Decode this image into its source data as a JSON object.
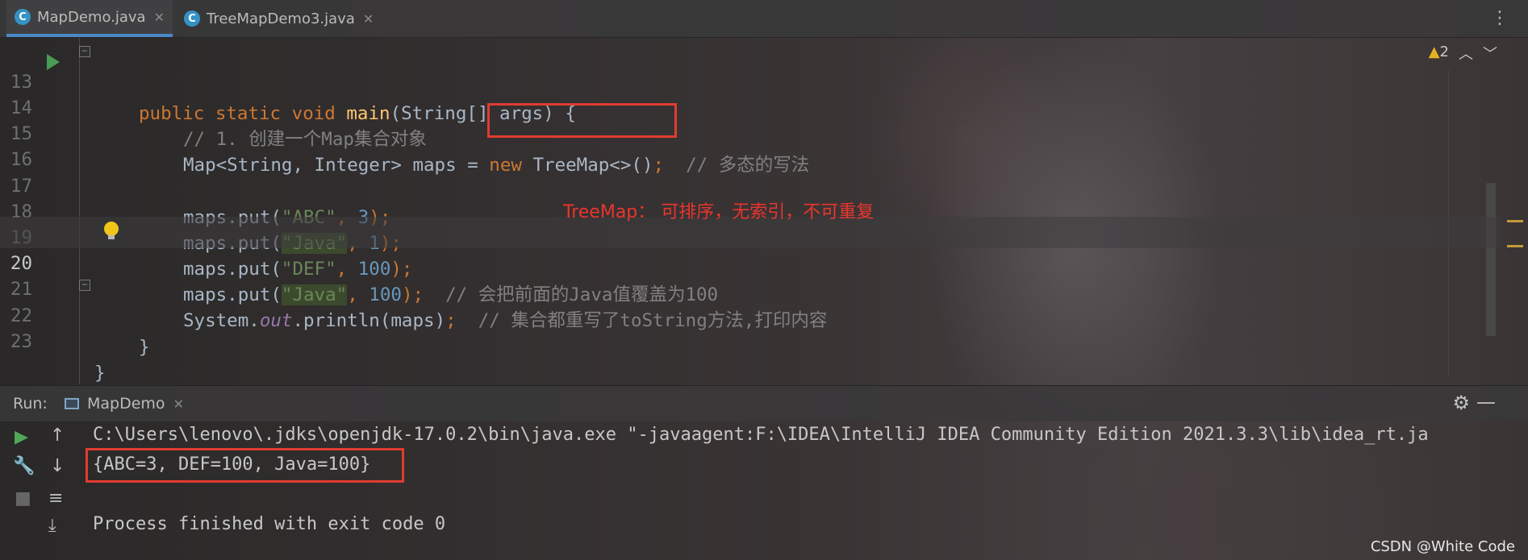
{
  "tabs": [
    {
      "label": "MapDemo.java",
      "icon": "C",
      "active": true
    },
    {
      "label": "TreeMapDemo3.java",
      "icon": "C",
      "active": false
    }
  ],
  "editor": {
    "warnings_count": "2",
    "lines": {
      "l13": {
        "num": "13",
        "indent": "    ",
        "kw1": "public",
        "kw2": "static",
        "kw3": "void",
        "fn": "main",
        "rest": "(String[] args) {"
      },
      "l14": {
        "num": "14",
        "comment": "// 1. 创建一个Map集合对象"
      },
      "l15": {
        "num": "15",
        "pre": "Map<String, Integer> maps = ",
        "kw": "new",
        "mid": " TreeMap<>()",
        "semi": ";",
        "comment": "// 多态的写法"
      },
      "l16": {
        "num": "16"
      },
      "l17": {
        "num": "17",
        "pre": "maps.put(",
        "str": "\"ABC\"",
        "sep": ", ",
        "num_val": "3",
        "end": ");"
      },
      "l18": {
        "num": "18",
        "pre": "maps.put(",
        "str": "\"Java\"",
        "sep": ", ",
        "num_val": "1",
        "end": ");"
      },
      "l19": {
        "num": "19",
        "pre": "maps.put(",
        "str": "\"DEF\"",
        "sep": ", ",
        "num_val": "100",
        "end": ");"
      },
      "l20": {
        "num": "20",
        "pre": "maps.put(",
        "str": "\"Java\"",
        "sep": ", ",
        "num_val": "100",
        "end": ");",
        "comment": "// 会把前面的Java值覆盖为100"
      },
      "l21": {
        "num": "21",
        "pre": "System.",
        "field": "out",
        "mid": ".println(maps)",
        "end": ";",
        "comment": "// 集合都重写了toString方法,打印内容"
      },
      "l22": {
        "num": "22",
        "brace": "}"
      },
      "l23": {
        "num": "23",
        "brace": "}"
      }
    },
    "annotation": "TreeMap： 可排序，无索引，不可重复"
  },
  "run": {
    "label": "Run:",
    "tab_label": "MapDemo",
    "console_lines": [
      "C:\\Users\\lenovo\\.jdks\\openjdk-17.0.2\\bin\\java.exe \"-javaagent:F:\\IDEA\\IntelliJ IDEA Community Edition 2021.3.3\\lib\\idea_rt.ja",
      "{ABC=3, DEF=100, Java=100}",
      "",
      "Process finished with exit code 0"
    ]
  },
  "watermark": "CSDN @White Code",
  "colors": {
    "accent": "#4a88c7",
    "highlight_box": "#e03c31",
    "keyword": "#cc7832",
    "string": "#6a8759",
    "number": "#6897bb"
  },
  "icons": [
    "java-class-icon",
    "close-icon",
    "more-vertical-icon",
    "run-gutter-icon",
    "fold-icon",
    "lightbulb-icon",
    "warning-icon",
    "chevron-up-icon",
    "chevron-down-icon",
    "gear-icon",
    "minimize-icon",
    "rerun-icon",
    "wrench-icon",
    "arrow-up-icon",
    "arrow-down-icon",
    "stop-icon",
    "soft-wrap-icon",
    "scroll-to-end-icon"
  ]
}
